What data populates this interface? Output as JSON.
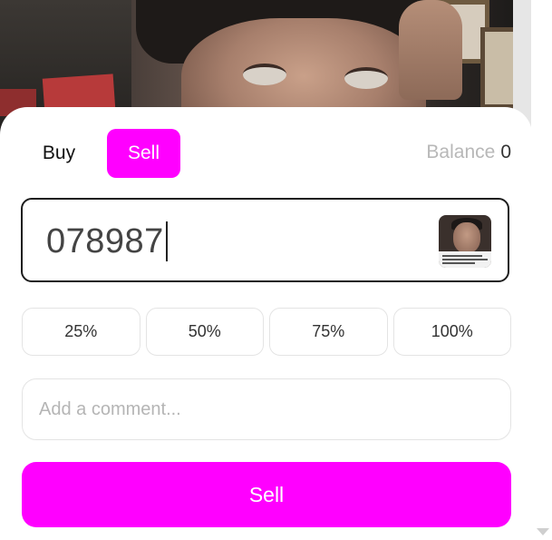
{
  "trade": {
    "mode_buy_label": "Buy",
    "mode_sell_label": "Sell",
    "active_mode": "Sell",
    "balance_label": "Balance",
    "balance_value": "0"
  },
  "amount": {
    "value": "078987",
    "token_icon": "token-thumbnail"
  },
  "quick_amounts": [
    {
      "label": "25%"
    },
    {
      "label": "50%"
    },
    {
      "label": "75%"
    },
    {
      "label": "100%"
    }
  ],
  "comment": {
    "placeholder": "Add a comment..."
  },
  "submit": {
    "label": "Sell"
  },
  "colors": {
    "accent": "#ff00ff",
    "balance_label": "#b8b8b8",
    "border": "#e4e4e4"
  }
}
